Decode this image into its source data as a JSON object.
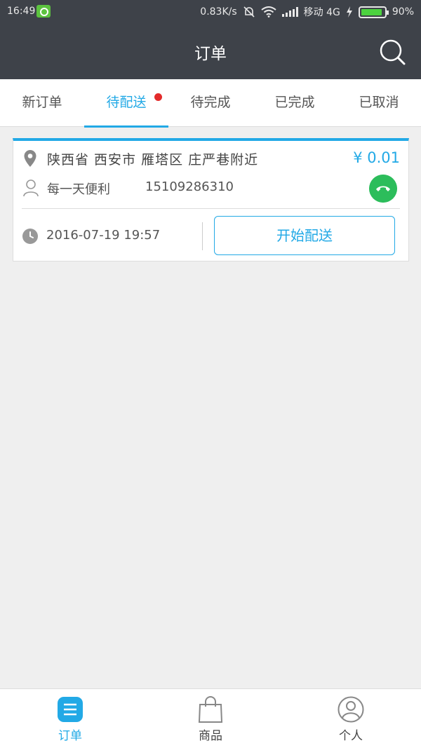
{
  "status_bar": {
    "time": "16:49",
    "network_speed": "0.83K/s",
    "carrier": "移动 4G",
    "battery": "90%",
    "battery_level": 0.9
  },
  "header": {
    "title": "订单"
  },
  "tabs": [
    {
      "label": "新订单",
      "active": false
    },
    {
      "label": "待配送",
      "active": true,
      "badge": true
    },
    {
      "label": "待完成",
      "active": false
    },
    {
      "label": "已完成",
      "active": false
    },
    {
      "label": "已取消",
      "active": false
    }
  ],
  "order": {
    "address": "陕西省 西安市 雁塔区 庄严巷附近",
    "price": "¥ 0.01",
    "shop_name": "每一天便利",
    "phone": "15109286310",
    "datetime": "2016-07-19 19:57",
    "action_label": "开始配送"
  },
  "bottom_nav": [
    {
      "label": "订单",
      "icon": "list-icon",
      "active": true
    },
    {
      "label": "商品",
      "icon": "shopping-bag-icon",
      "active": false
    },
    {
      "label": "个人",
      "icon": "user-icon",
      "active": false
    }
  ],
  "colors": {
    "accent": "#22a9e6",
    "header": "#3e4249",
    "call": "#2cbd5b",
    "badge": "#e32b2b"
  }
}
